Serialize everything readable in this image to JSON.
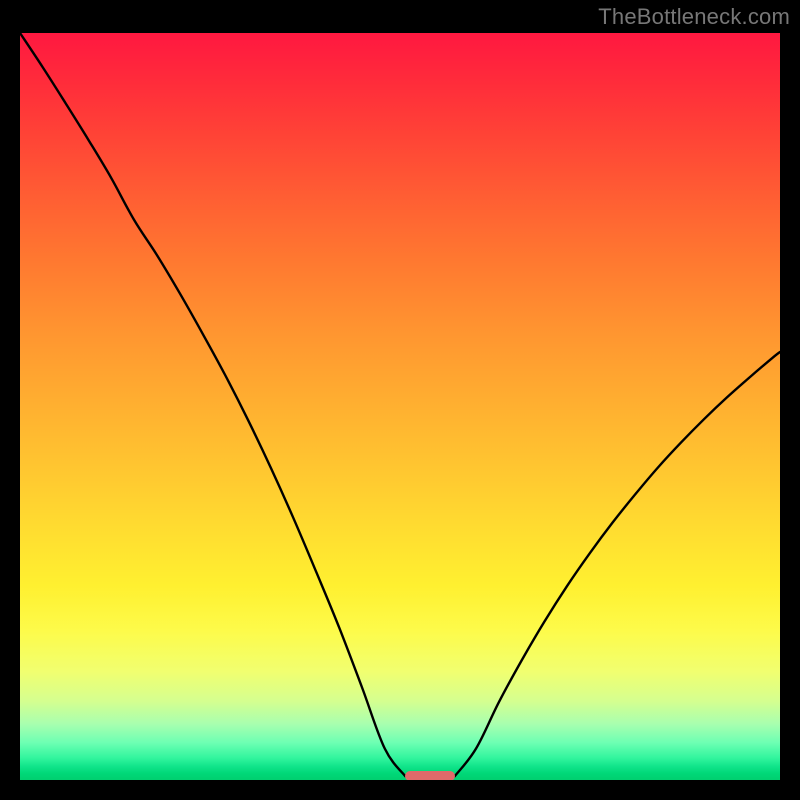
{
  "watermark": "TheBottleneck.com",
  "chart_data": {
    "type": "line",
    "title": "",
    "xlabel": "",
    "ylabel": "",
    "xlim": [
      0,
      100
    ],
    "ylim": [
      0,
      100
    ],
    "grid": false,
    "legend": false,
    "series": [
      {
        "name": "left-curve",
        "x": [
          0,
          3,
          6,
          9,
          12,
          15,
          18,
          21,
          24,
          27,
          30,
          33,
          36,
          39,
          42,
          45,
          48,
          50.7
        ],
        "values": [
          100.0,
          95.4,
          90.6,
          85.7,
          80.6,
          75.0,
          70.3,
          65.2,
          59.8,
          54.2,
          48.2,
          41.8,
          35.0,
          27.8,
          20.4,
          12.4,
          4.2,
          0.5
        ]
      },
      {
        "name": "right-curve",
        "x": [
          57.2,
          60,
          63,
          66,
          69,
          72,
          75,
          78,
          81,
          84,
          87,
          90,
          93,
          96,
          99,
          100
        ],
        "values": [
          0.5,
          4.2,
          10.4,
          16.0,
          21.2,
          26.0,
          30.4,
          34.5,
          38.3,
          41.9,
          45.2,
          48.3,
          51.2,
          53.9,
          56.5,
          57.3
        ]
      }
    ],
    "marker": {
      "name": "bottleneck-indicator",
      "x_center": 54.0,
      "x_min": 50.7,
      "x_max": 57.2,
      "y": 0.5,
      "color": "#e06a6a"
    },
    "background_gradient": {
      "direction": "vertical",
      "stops": [
        {
          "y": 100,
          "color": "#ff1840"
        },
        {
          "y": 75,
          "color": "#ff7a30"
        },
        {
          "y": 50,
          "color": "#ffb030"
        },
        {
          "y": 25,
          "color": "#fff030"
        },
        {
          "y": 10,
          "color": "#d4ff90"
        },
        {
          "y": 0,
          "color": "#00cf6f"
        }
      ]
    }
  }
}
